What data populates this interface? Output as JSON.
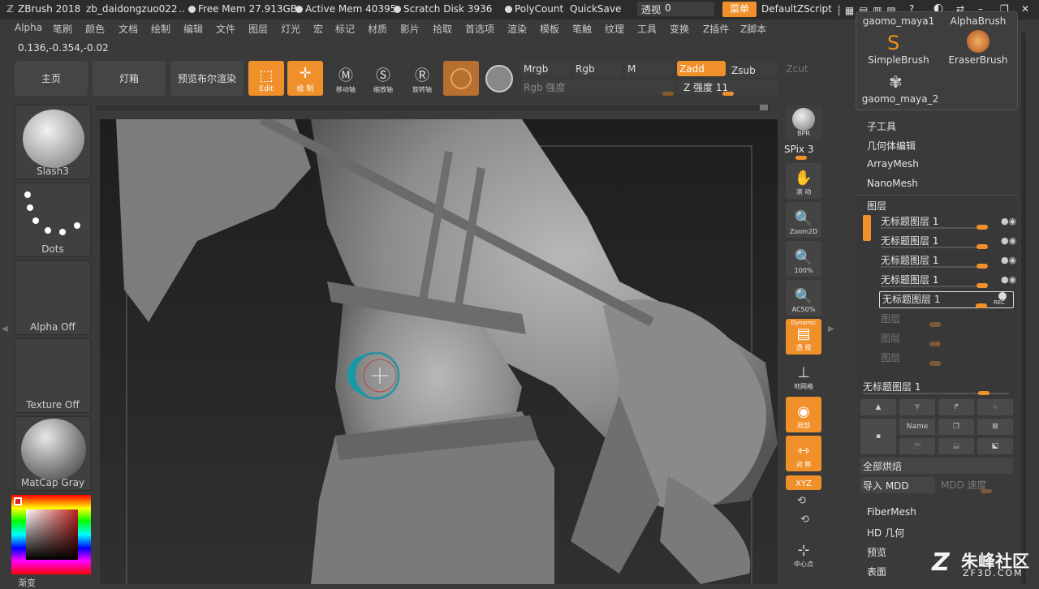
{
  "titlebar": {
    "app": "ZBrush 2018",
    "file": "zb_daidongzuo022",
    "sep": "..",
    "free_mem": "Free Mem 27.913GB",
    "active_mem": "Active Mem 40395",
    "scratch": "Scratch Disk 3936",
    "polycount": "PolyCount",
    "quicksave": "QuickSave",
    "perspective_label": "透视",
    "perspective_value": "0",
    "menu_btn": "菜单",
    "script": "DefaultZScript"
  },
  "menubar": [
    "Alpha",
    "笔刷",
    "颜色",
    "文档",
    "绘制",
    "编辑",
    "文件",
    "图层",
    "灯光",
    "宏",
    "标记",
    "材质",
    "影片",
    "拾取",
    "首选项",
    "渲染",
    "模板",
    "笔触",
    "纹理",
    "工具",
    "变换",
    "Z插件",
    "Z脚本"
  ],
  "coords": "0.136,-0.354,-0.02",
  "topbar": {
    "home": "主页",
    "lightbox": "灯箱",
    "bpr": "预览布尔渲染",
    "edit": "Edit",
    "draw": "绘 制",
    "move": "移动轴",
    "scale": "缩放轴",
    "rotate": "旋转轴",
    "mrgb": "Mrgb",
    "rgb": "Rgb",
    "m": "M",
    "zadd": "Zadd",
    "zsub": "Zsub",
    "zcut": "Zcut",
    "rgb_intensity": "Rgb 强度",
    "z_intensity": "Z 强度 11"
  },
  "leftpanel": {
    "brush": "Slash3",
    "stroke": "Dots",
    "alpha": "Alpha Off",
    "texture": "Texture Off",
    "material": "MatCap Gray",
    "gradient": "渐变"
  },
  "rightshelf": {
    "bpr": "BPR",
    "spix": "SPix 3",
    "scroll": "滚 动",
    "zoom2d": "Zoom2D",
    "actual": "100%",
    "ac50": "AC50%",
    "dynamic": "Dynamic",
    "persp": "透 视",
    "floor": "地网格",
    "local": "局部",
    "sym": "对 称",
    "xyz": "XYZ",
    "center": "中心点"
  },
  "toolpalette": {
    "brushes": [
      "gaomo_maya1",
      "AlphaBrush",
      "SimpleBrush",
      "EraserBrush",
      "gaomo_maya_2"
    ],
    "sections": [
      "子工具",
      "几何体编辑",
      "ArrayMesh",
      "NanoMesh"
    ],
    "layers_title": "图层",
    "layers": [
      "无标题图层 1",
      "无标题图层 1",
      "无标题图层 1",
      "无标题图层 1",
      "无标题图层 1"
    ],
    "empty_layers": [
      "图层",
      "图层",
      "图层"
    ],
    "rec": "REC",
    "current_layer": "无标题图层 1",
    "name_btn": "Name",
    "bake_all": "全部烘焙",
    "import_mdd": "导入 MDD",
    "mdd_speed": "MDD 速度",
    "bottom_sections": [
      "FiberMesh",
      "HD 几何",
      "预览",
      "表面"
    ]
  },
  "watermark": {
    "brand": "朱峰社区",
    "url": "ZF3D.COM"
  },
  "colors": {
    "accent": "#f0902a",
    "panel": "#3a3a3a",
    "titlebar": "#2c2c2c"
  }
}
